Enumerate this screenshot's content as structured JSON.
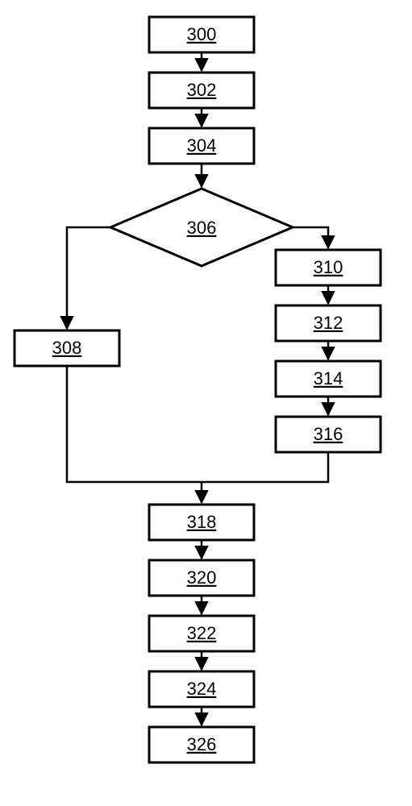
{
  "chart_data": {
    "type": "flowchart",
    "nodes": [
      {
        "id": "n300",
        "label": "300",
        "shape": "rect"
      },
      {
        "id": "n302",
        "label": "302",
        "shape": "rect"
      },
      {
        "id": "n304",
        "label": "304",
        "shape": "rect"
      },
      {
        "id": "n306",
        "label": "306",
        "shape": "diamond"
      },
      {
        "id": "n308",
        "label": "308",
        "shape": "rect"
      },
      {
        "id": "n310",
        "label": "310",
        "shape": "rect"
      },
      {
        "id": "n312",
        "label": "312",
        "shape": "rect"
      },
      {
        "id": "n314",
        "label": "314",
        "shape": "rect"
      },
      {
        "id": "n316",
        "label": "316",
        "shape": "rect"
      },
      {
        "id": "n318",
        "label": "318",
        "shape": "rect"
      },
      {
        "id": "n320",
        "label": "320",
        "shape": "rect"
      },
      {
        "id": "n322",
        "label": "322",
        "shape": "rect"
      },
      {
        "id": "n324",
        "label": "324",
        "shape": "rect"
      },
      {
        "id": "n326",
        "label": "326",
        "shape": "rect"
      }
    ],
    "edges": [
      {
        "from": "n300",
        "to": "n302"
      },
      {
        "from": "n302",
        "to": "n304"
      },
      {
        "from": "n304",
        "to": "n306"
      },
      {
        "from": "n306",
        "to": "n308"
      },
      {
        "from": "n306",
        "to": "n310"
      },
      {
        "from": "n310",
        "to": "n312"
      },
      {
        "from": "n312",
        "to": "n314"
      },
      {
        "from": "n314",
        "to": "n316"
      },
      {
        "from": "n308",
        "to": "n318"
      },
      {
        "from": "n316",
        "to": "n318"
      },
      {
        "from": "n318",
        "to": "n320"
      },
      {
        "from": "n320",
        "to": "n322"
      },
      {
        "from": "n322",
        "to": "n324"
      },
      {
        "from": "n324",
        "to": "n326"
      }
    ]
  }
}
